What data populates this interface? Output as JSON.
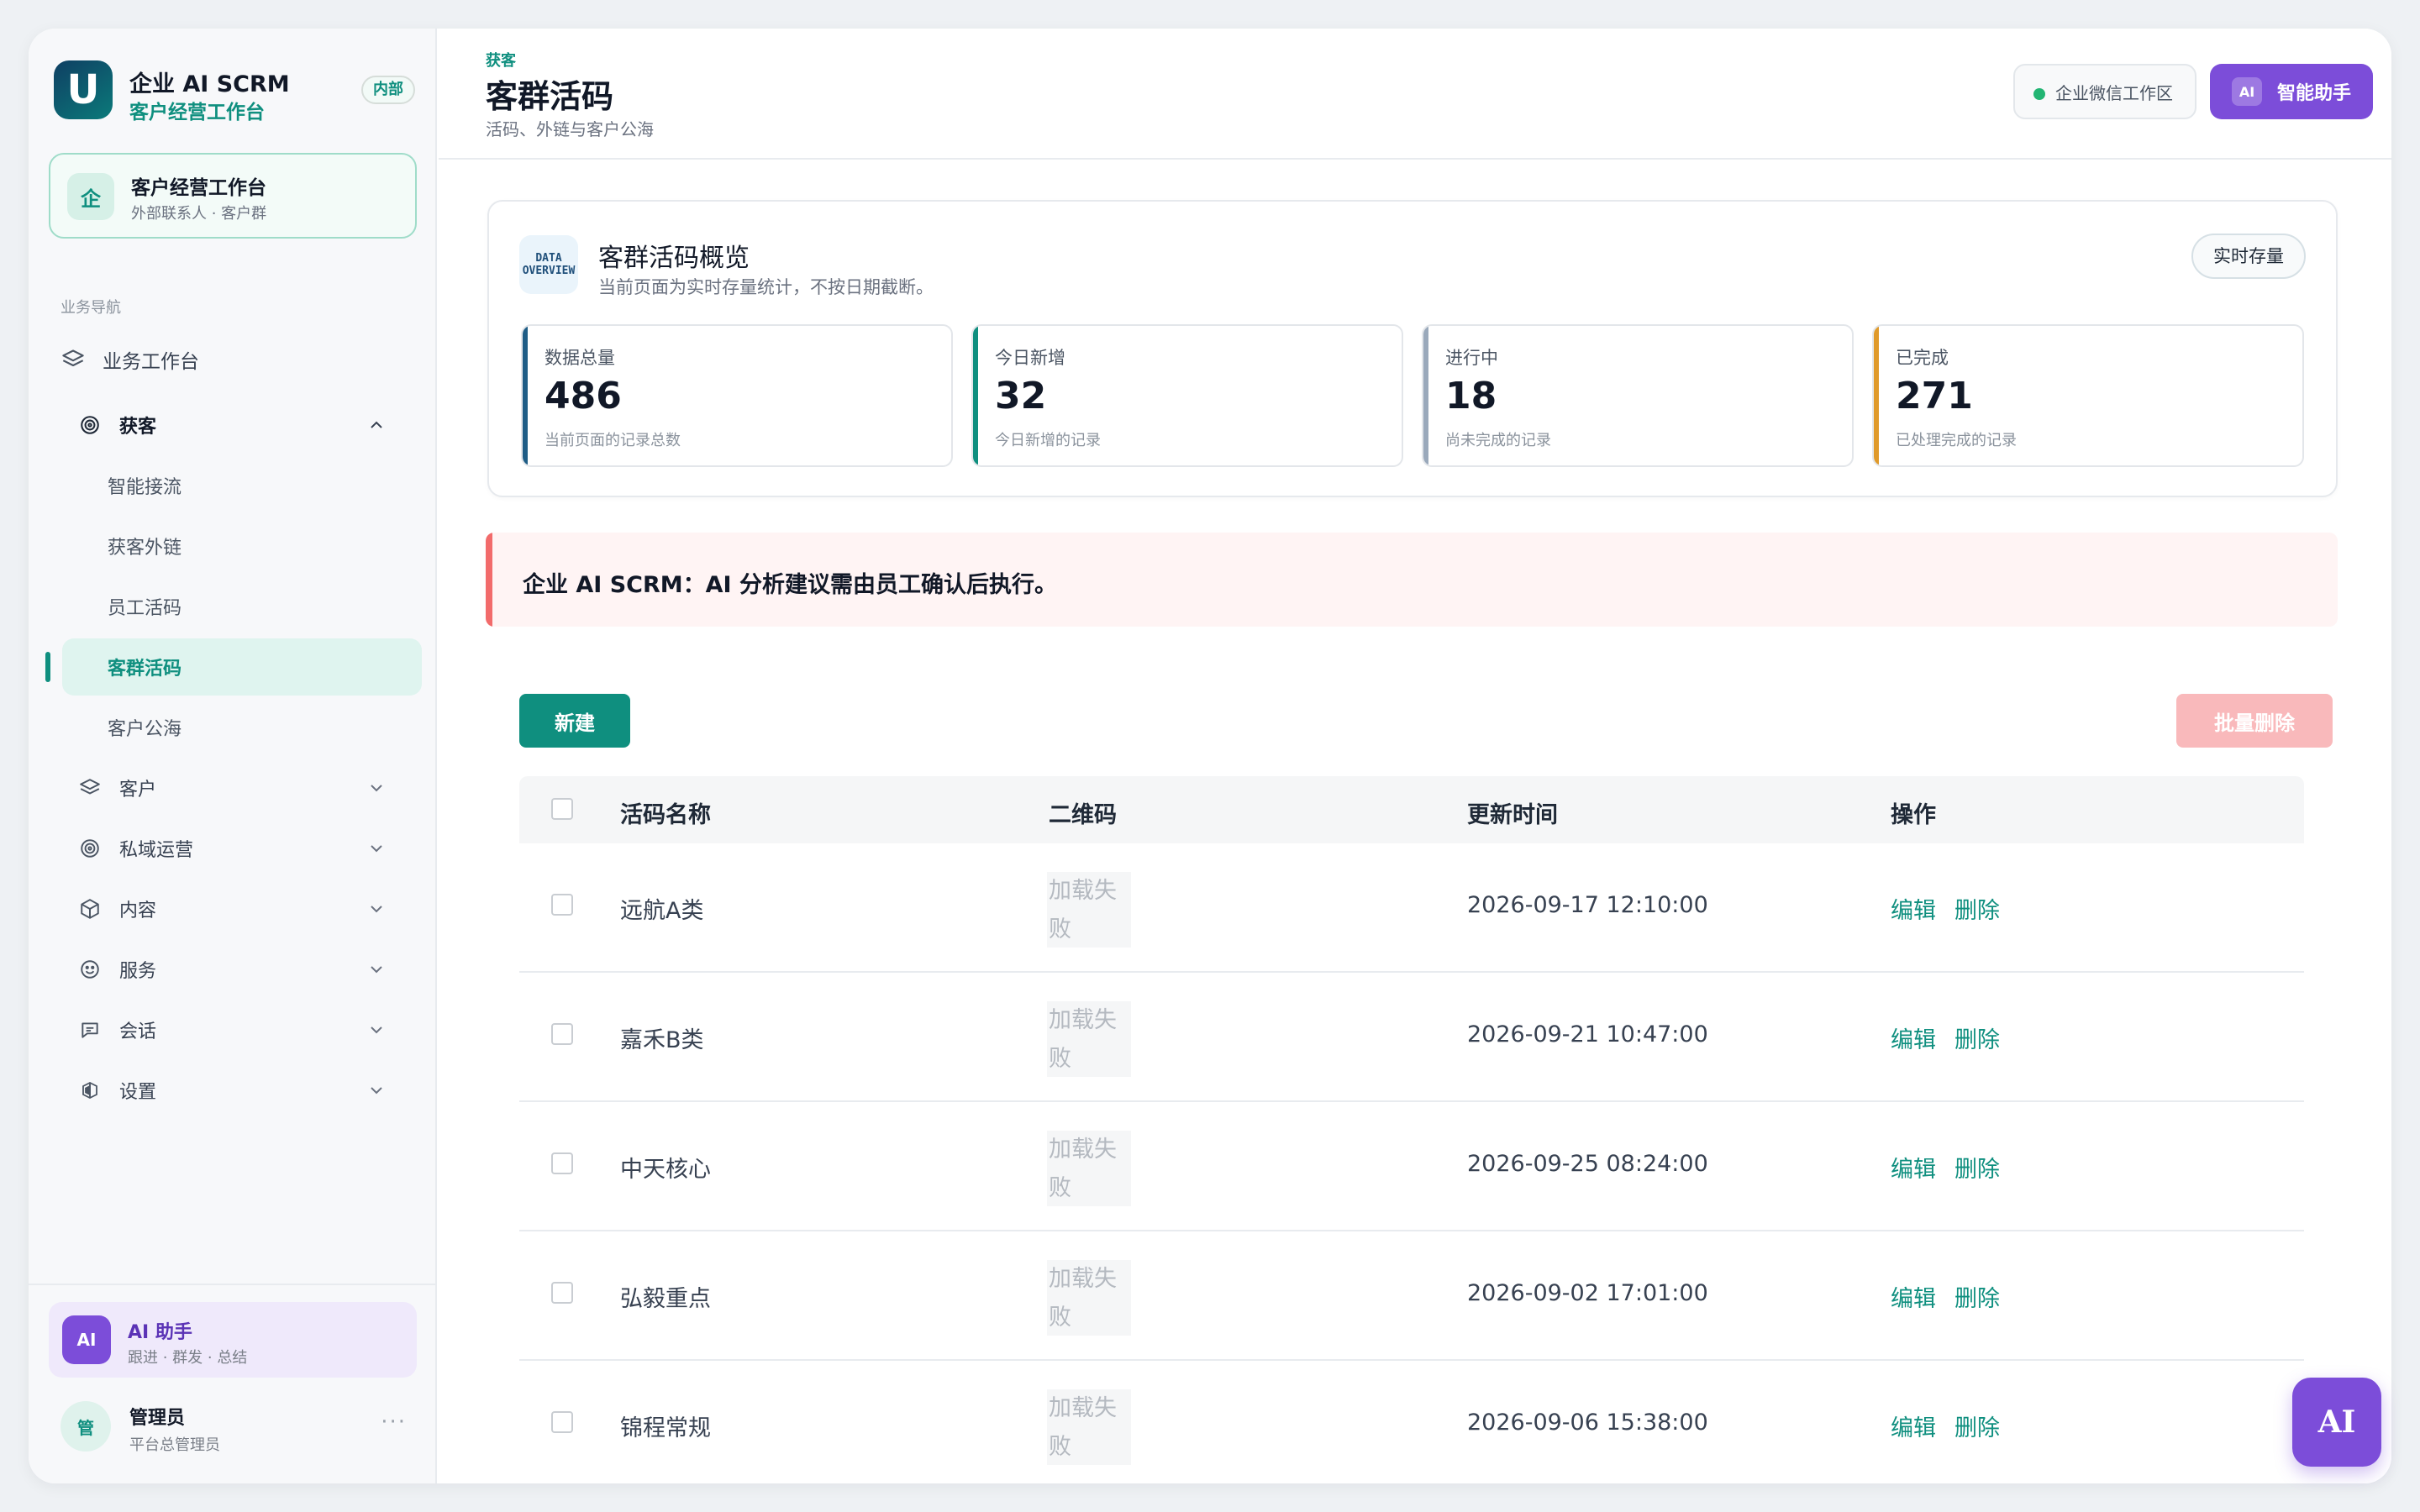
{
  "brand": {
    "logo_letter": "U",
    "title": "企业 AI SCRM",
    "subtitle": "客户经营工作台",
    "badge": "内部"
  },
  "workspace": {
    "icon_char": "企",
    "title": "客户经营工作台",
    "subtitle": "外部联系人 · 客户群"
  },
  "nav": {
    "section_label": "业务导航",
    "workbench": "业务工作台",
    "acquire": {
      "label": "获客",
      "children": [
        "智能接流",
        "获客外链",
        "员工活码",
        "客群活码",
        "客户公海"
      ]
    },
    "groups": [
      {
        "label": "客户",
        "icon": "layers-icon"
      },
      {
        "label": "私域运营",
        "icon": "target-icon"
      },
      {
        "label": "内容",
        "icon": "cube-icon"
      },
      {
        "label": "服务",
        "icon": "smile-icon"
      },
      {
        "label": "会话",
        "icon": "chat-icon"
      },
      {
        "label": "设置",
        "icon": "settings-icon"
      }
    ]
  },
  "assistant_card": {
    "avatar": "AI",
    "title": "AI 助手",
    "subtitle": "跟进 · 群发 · 总结"
  },
  "user": {
    "avatar": "管",
    "name": "管理员",
    "role": "平台总管理员",
    "more": "···"
  },
  "header": {
    "breadcrumb": "获客",
    "title": "客群活码",
    "subtitle": "活码、外链与客户公海",
    "env_label": "企业微信工作区",
    "ai_tag": "AI",
    "ai_button": "智能助手"
  },
  "overview": {
    "icon_text": "DATA OVERVIEW",
    "title": "客群活码概览",
    "subtitle": "当前页面为实时存量统计，不按日期截断。",
    "pill": "实时存量",
    "stats": [
      {
        "label": "数据总量",
        "value": "486",
        "desc": "当前页面的记录总数",
        "color": "#1f5d86"
      },
      {
        "label": "今日新增",
        "value": "32",
        "desc": "今日新增的记录",
        "color": "#0f8f7f"
      },
      {
        "label": "进行中",
        "value": "18",
        "desc": "尚未完成的记录",
        "color": "#9aa9bb"
      },
      {
        "label": "已完成",
        "value": "271",
        "desc": "已处理完成的记录",
        "color": "#e09a2a"
      }
    ]
  },
  "alert": {
    "text": "企业 AI SCRM：AI 分析建议需由员工确认后执行。"
  },
  "toolbar": {
    "new_label": "新建",
    "bulk_delete_label": "批量删除"
  },
  "table": {
    "columns": [
      "活码名称",
      "二维码",
      "更新时间",
      "操作"
    ],
    "rows": [
      {
        "name": "远航A类",
        "qr": "加载失败",
        "time": "2026-09-17 12:10:00"
      },
      {
        "name": "嘉禾B类",
        "qr": "加载失败",
        "time": "2026-09-21 10:47:00"
      },
      {
        "name": "中天核心",
        "qr": "加载失败",
        "time": "2026-09-25 08:24:00"
      },
      {
        "name": "弘毅重点",
        "qr": "加载失败",
        "time": "2026-09-02 17:01:00"
      },
      {
        "name": "锦程常规",
        "qr": "加载失败",
        "time": "2026-09-06 15:38:00"
      }
    ],
    "edit_label": "编辑",
    "delete_label": "删除"
  },
  "fab_label": "AI",
  "colors": {
    "primary": "#0f8f7f",
    "accent_purple": "#7c4dd9",
    "danger": "#f26b6b"
  }
}
